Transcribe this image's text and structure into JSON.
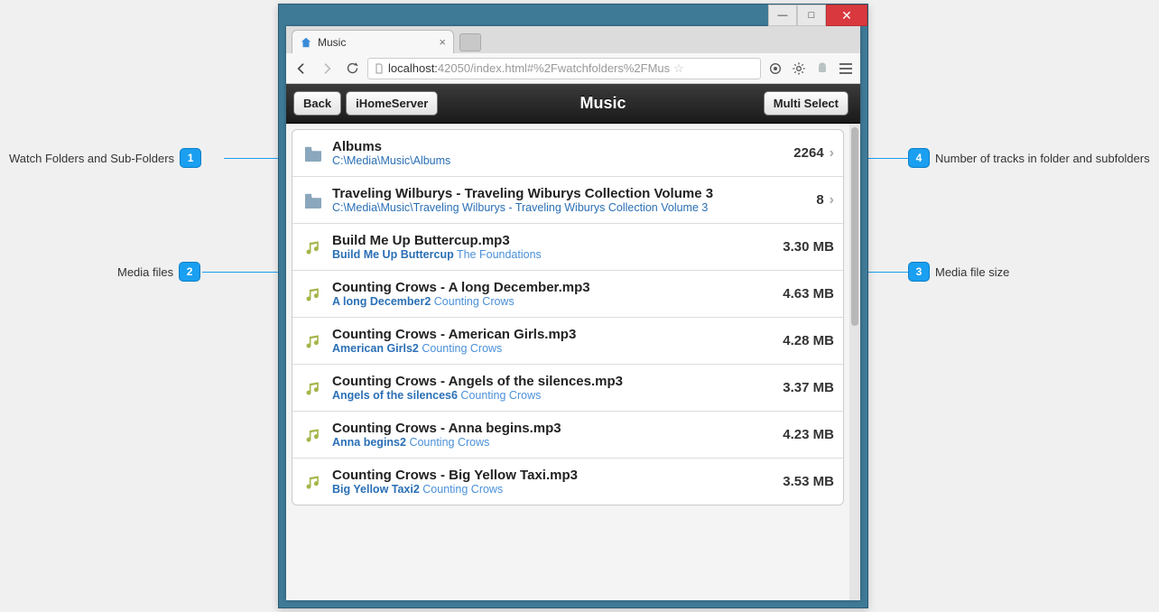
{
  "browser": {
    "tab_title": "Music",
    "url_host": "localhost:",
    "url_rest": "42050/index.html#%2Fwatchfolders%2FMus",
    "window_buttons": {
      "min": "—",
      "max": "▢",
      "close": "✕"
    }
  },
  "app": {
    "back_label": "Back",
    "home_label": "iHomeServer",
    "title": "Music",
    "multiselect_label": "Multi Select"
  },
  "folders": [
    {
      "title": "Albums",
      "path": "C:\\Media\\Music\\Albums",
      "count": "2264"
    },
    {
      "title": "Traveling Wilburys - Traveling Wiburys Collection Volume 3",
      "path": "C:\\Media\\Music\\Traveling Wilburys - Traveling Wiburys Collection Volume 3",
      "count": "8"
    }
  ],
  "files": [
    {
      "filename": "Build Me Up Buttercup.mp3",
      "song": "Build Me Up Buttercup",
      "artist": "The Foundations",
      "size": "3.30 MB"
    },
    {
      "filename": "Counting Crows - A long December.mp3",
      "song": "A long December2",
      "artist": "Counting Crows",
      "size": "4.63 MB"
    },
    {
      "filename": "Counting Crows - American Girls.mp3",
      "song": "American Girls2",
      "artist": "Counting Crows",
      "size": "4.28 MB"
    },
    {
      "filename": "Counting Crows - Angels of the silences.mp3",
      "song": "Angels of the silences6",
      "artist": "Counting Crows",
      "size": "3.37 MB"
    },
    {
      "filename": "Counting Crows - Anna begins.mp3",
      "song": "Anna begins2",
      "artist": "Counting Crows",
      "size": "4.23 MB"
    },
    {
      "filename": "Counting Crows - Big Yellow Taxi.mp3",
      "song": "Big Yellow Taxi2",
      "artist": "Counting Crows",
      "size": "3.53 MB"
    }
  ],
  "callouts": {
    "c1": "Watch Folders and Sub-Folders",
    "c2": "Media files",
    "c3": "Media file size",
    "c4": "Number of tracks in folder and subfolders"
  }
}
